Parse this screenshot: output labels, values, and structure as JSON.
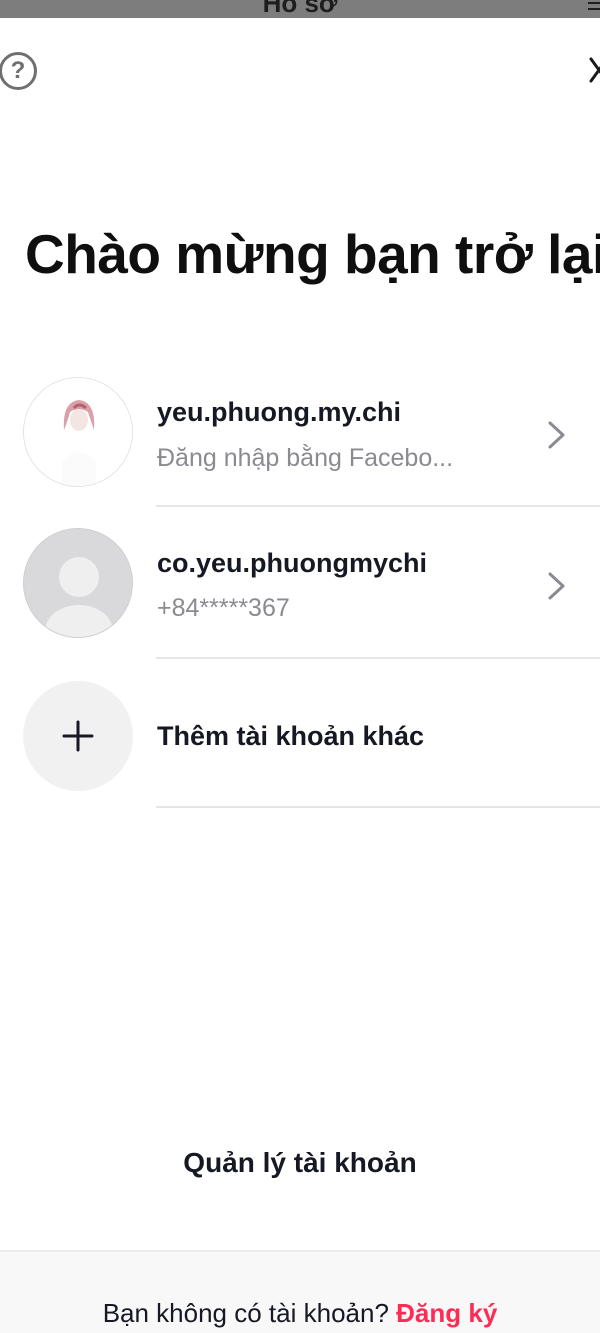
{
  "top_bar": {
    "title": "Hồ sơ"
  },
  "heading": "Chào mừng bạn trở lại",
  "accounts": [
    {
      "username": "yeu.phuong.my.chi",
      "subtitle": "Đăng nhập bằng Facebo..."
    },
    {
      "username": "co.yeu.phuongmychi",
      "subtitle": "+84*****367"
    }
  ],
  "add_account_label": "Thêm tài khoản khác",
  "manage_accounts_label": "Quản lý tài khoản",
  "footer": {
    "prompt": "Bạn không có tài khoản?",
    "signup_label": "Đăng ký"
  },
  "colors": {
    "accent": "#fe2c55",
    "text": "#161823",
    "secondary_text": "#8a8b91",
    "divider": "#e6e6e8"
  },
  "icons": {
    "help": "help-icon",
    "close": "close-icon",
    "chevron": "chevron-right-icon",
    "add": "plus-icon",
    "menu": "menu-icon"
  }
}
